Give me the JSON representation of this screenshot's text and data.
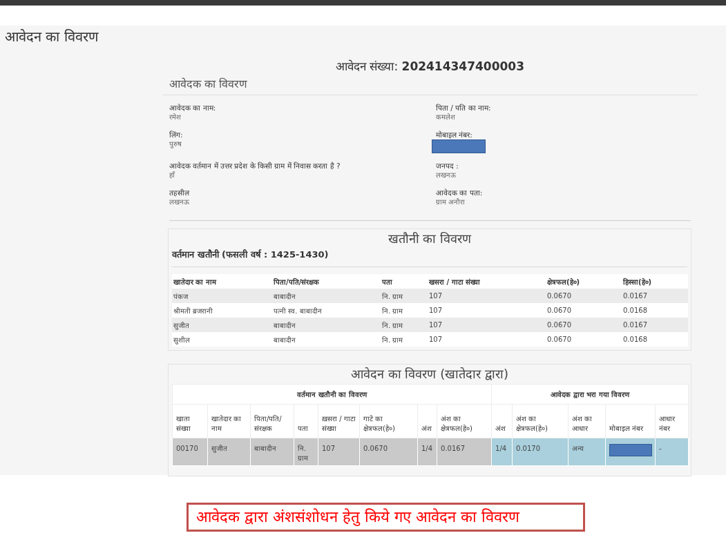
{
  "page_title": "आवेदन का विवरण",
  "application_number": {
    "label": "आवेदन संख्या:",
    "value": "202414347400003"
  },
  "applicant": {
    "heading": "आवेदक का विवरण",
    "fields": [
      {
        "kind": "text",
        "label": "आवेदक का नाम:",
        "value": "रमेश"
      },
      {
        "kind": "text",
        "label": "पिता / पति का नाम:",
        "value": "कमलेश"
      },
      {
        "kind": "text",
        "label": "लिंग:",
        "value": "पुरुष"
      },
      {
        "kind": "redacted",
        "label": "मोबाइल नंबर:"
      },
      {
        "kind": "text",
        "label": "आवेदक वर्तमान में उत्तर प्रदेश के किसी ग्राम में निवास करता है ?",
        "value": "हाँ"
      },
      {
        "kind": "text",
        "label": "जनपद :",
        "value": "लखनऊ"
      },
      {
        "kind": "text",
        "label": "तहसील",
        "value": "लखनऊ"
      },
      {
        "kind": "text",
        "label": "आवेदक का पता:",
        "value": "ग्राम अनौरा"
      }
    ]
  },
  "khatauni": {
    "title": "खतौनी का विवरण",
    "subtitle": "वर्तमान खतौनी (फसली वर्ष : 1425-1430)",
    "columns": [
      "खातेदार का नाम",
      "पिता/पति/संरक्षक",
      "पता",
      "खसरा / गाटा संख्या",
      "क्षेत्रफल(हे०)",
      "हिस्सा(हे०)"
    ],
    "rows": [
      [
        "पंकज",
        "बाबादीन",
        "नि. ग्राम",
        "107",
        "0.0670",
        "0.0167"
      ],
      [
        "श्रीमती ब्रजरानी",
        "पत्नी स्व. बाबादीन",
        "नि. ग्राम",
        "107",
        "0.0670",
        "0.0168"
      ],
      [
        "सुजीत",
        "बाबादीन",
        "नि. ग्राम",
        "107",
        "0.0670",
        "0.0167"
      ],
      [
        "सुशील",
        "बाबादीन",
        "नि. ग्राम",
        "107",
        "0.0670",
        "0.0168"
      ]
    ]
  },
  "application": {
    "title": "आवेदन का विवरण (खातेदार द्वारा)",
    "groups": [
      {
        "label": "वर्तमान खतौनी का विवरण",
        "columns": [
          "खाता संख्या",
          "खातेदार का नाम",
          "पिता/पति/संरक्षक",
          "पता",
          "ख़सरा / गाटा संख्या",
          "गाटे का क्षेत्रफल(हे०)",
          "अंश",
          "अंश का क्षेत्रफल(हे०)"
        ]
      },
      {
        "label": "आवेदक द्वारा भरा गया विवरण",
        "columns": [
          "अंश",
          "अंश का क्षेत्रफल(हे०)",
          "अंश का आधार",
          "मोबाइल नंबर",
          "आधार नंबर"
        ]
      }
    ],
    "rows": [
      {
        "parts": [
          [
            {
              "kind": "text",
              "text": "00170"
            },
            {
              "kind": "text",
              "text": "सुजीत"
            },
            {
              "kind": "text",
              "text": "बाबादीन"
            },
            {
              "kind": "text",
              "text": "नि. ग्राम"
            },
            {
              "kind": "text",
              "text": "107"
            },
            {
              "kind": "text",
              "text": "0.0670"
            },
            {
              "kind": "text",
              "text": "1/4"
            },
            {
              "kind": "text",
              "text": "0.0167"
            }
          ],
          [
            {
              "kind": "text",
              "text": "1/4"
            },
            {
              "kind": "text",
              "text": "0.0170"
            },
            {
              "kind": "text",
              "text": "अन्य"
            },
            {
              "kind": "redacted"
            },
            {
              "kind": "text",
              "text": "-"
            }
          ]
        ]
      }
    ]
  },
  "caption": "आवेदक द्वारा अंशसंशोधन हेतु किये गए आवेदन का विवरण"
}
